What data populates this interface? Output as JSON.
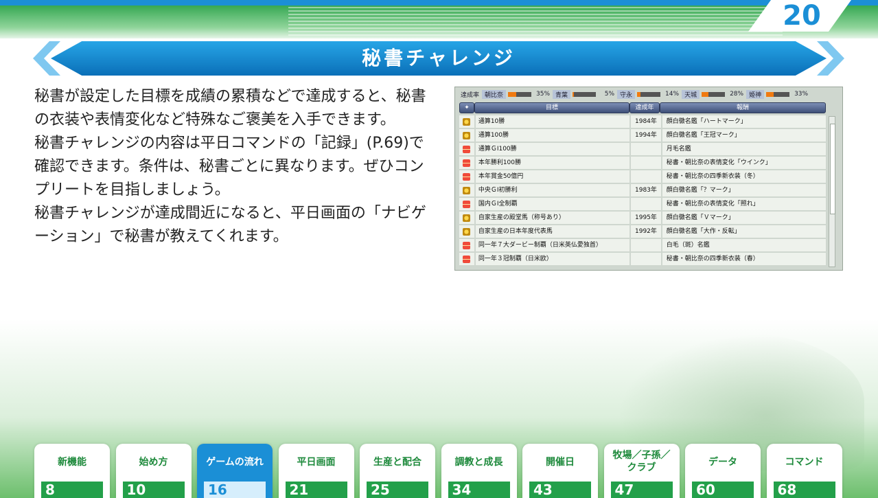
{
  "page_number": "20",
  "title": "秘書チャレンジ",
  "body": [
    "秘書が設定した目標を成績の累積などで達成すると、秘書の衣装や表情変化など特殊なご褒美を入手できます。",
    "秘書チャレンジの内容は平日コマンドの「記録」(P.69)で確認できます。条件は、秘書ごとに異なります。ぜひコンプリートを目指しましょう。",
    "秘書チャレンジが達成間近になると、平日画面の「ナビゲーション」で秘書が教えてくれます。"
  ],
  "screenshot": {
    "rate_label": "達成率",
    "rates": [
      {
        "name": "朝比奈",
        "pct": "35%",
        "value": 35
      },
      {
        "name": "青葉",
        "pct": "5%",
        "value": 5
      },
      {
        "name": "守永",
        "pct": "14%",
        "value": 14
      },
      {
        "name": "天城",
        "pct": "28%",
        "value": 28
      },
      {
        "name": "姫神",
        "pct": "33%",
        "value": 33
      }
    ],
    "headers": {
      "goal": "目標",
      "year": "達成年",
      "reward": "報酬"
    },
    "rows": [
      {
        "icon": "medal",
        "goal": "通算10勝",
        "year": "1984年",
        "reward": "顔白黴名鑑「ハートマーク」"
      },
      {
        "icon": "medal",
        "goal": "通算100勝",
        "year": "1994年",
        "reward": "顔白黴名鑑「王冠マーク」"
      },
      {
        "icon": "gift",
        "goal": "通算ＧⅠ100勝",
        "year": "",
        "reward": "月毛名鑑"
      },
      {
        "icon": "gift",
        "goal": "本年勝利100勝",
        "year": "",
        "reward": "秘書・朝比奈の表情変化「ウインク」"
      },
      {
        "icon": "gift",
        "goal": "本年賞金50億円",
        "year": "",
        "reward": "秘書・朝比奈の四季新衣装（冬）"
      },
      {
        "icon": "medal",
        "goal": "中央ＧⅠ初勝利",
        "year": "1983年",
        "reward": "顔白黴名鑑「？マーク」"
      },
      {
        "icon": "gift",
        "goal": "国内ＧⅠ全制覇",
        "year": "",
        "reward": "秘書・朝比奈の表情変化「照れ」"
      },
      {
        "icon": "medal",
        "goal": "自家生産の殿堂馬（称号あり）",
        "year": "1995年",
        "reward": "顔白黴名鑑「Ｖマーク」"
      },
      {
        "icon": "medal",
        "goal": "自家生産の日本年度代表馬",
        "year": "1992年",
        "reward": "顔白黴名鑑「大作・反転」"
      },
      {
        "icon": "gift",
        "goal": "同一年７大ダービー制覇（日米英仏愛独首）",
        "year": "",
        "reward": "白毛（斑）名鑑"
      },
      {
        "icon": "gift",
        "goal": "同一年３冠制覇（日米欧）",
        "year": "",
        "reward": "秘書・朝比奈の四季新衣装（春）"
      }
    ]
  },
  "nav": [
    {
      "label": "新機能",
      "page": "8",
      "active": false
    },
    {
      "label": "始め方",
      "page": "10",
      "active": false
    },
    {
      "label": "ゲームの流れ",
      "page": "16",
      "active": true
    },
    {
      "label": "平日画面",
      "page": "21",
      "active": false
    },
    {
      "label": "生産と配合",
      "page": "25",
      "active": false
    },
    {
      "label": "調教と成長",
      "page": "34",
      "active": false
    },
    {
      "label": "開催日",
      "page": "43",
      "active": false
    },
    {
      "label": "牧場／子孫／クラブ",
      "label_line1": "牧場／子孫／",
      "label_line2": "クラブ",
      "page": "47",
      "active": false
    },
    {
      "label": "データ",
      "page": "60",
      "active": false
    },
    {
      "label": "コマンド",
      "page": "68",
      "active": false
    }
  ],
  "colors": {
    "accent_blue": "#1b8fd6",
    "accent_green": "#23a04a",
    "tab_label_green": "#1e8a3c"
  }
}
